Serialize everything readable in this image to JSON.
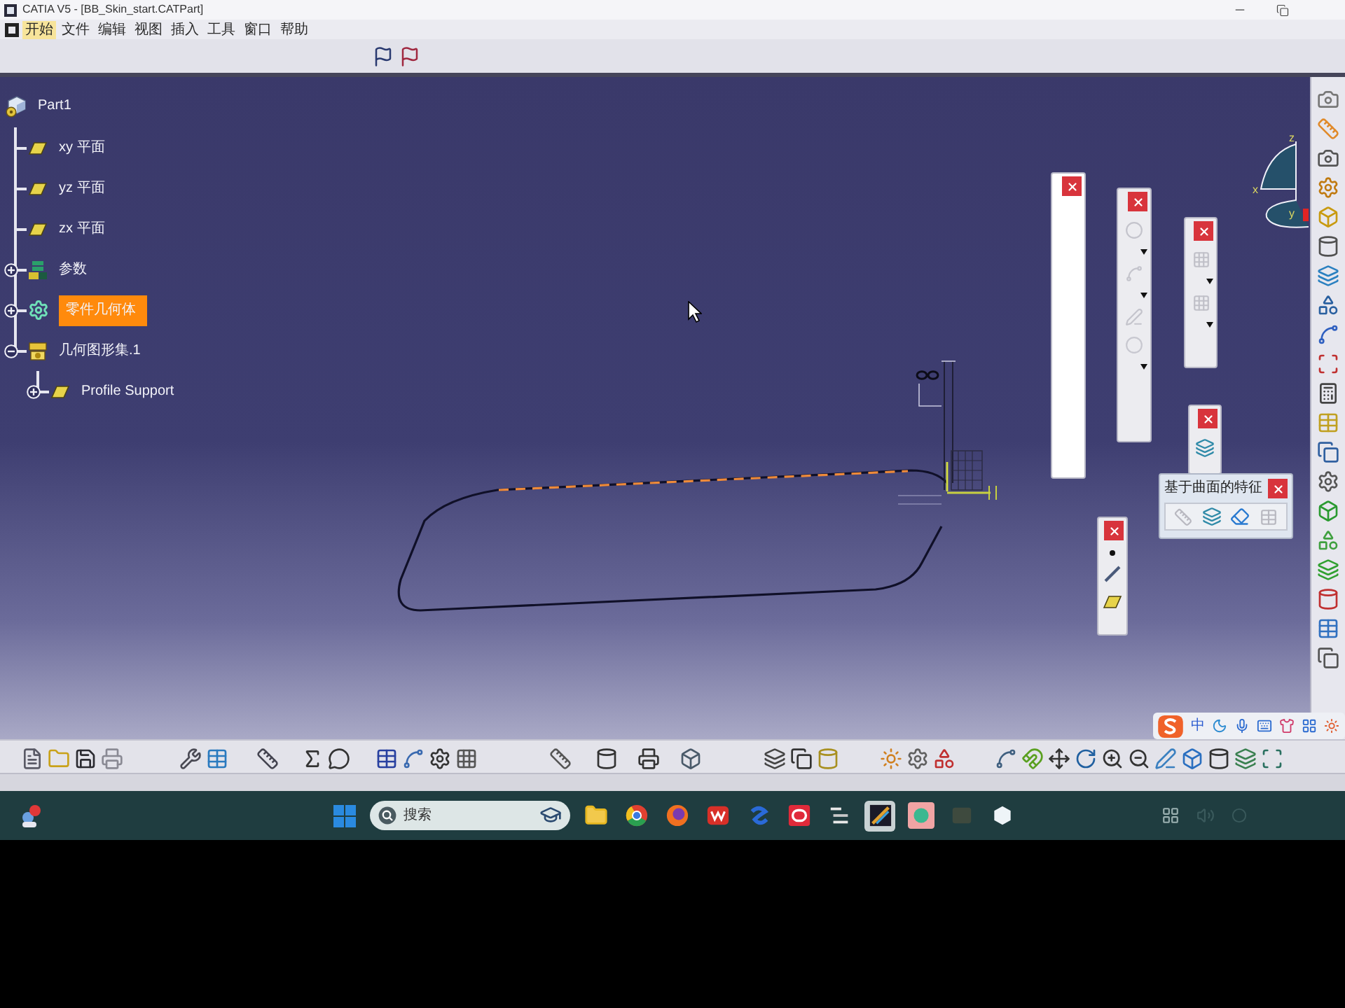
{
  "window": {
    "title": "CATIA V5 - [BB_Skin_start.CATPart]"
  },
  "menu": [
    {
      "label": "开始",
      "selected": true
    },
    {
      "label": "文件",
      "selected": false
    },
    {
      "label": "编辑",
      "selected": false
    },
    {
      "label": "视图",
      "selected": false
    },
    {
      "label": "插入",
      "selected": false
    },
    {
      "label": "工具",
      "selected": false
    },
    {
      "label": "窗口",
      "selected": false
    },
    {
      "label": "帮助",
      "selected": false
    }
  ],
  "tree": {
    "label": "Part1",
    "kind": "part",
    "children": [
      {
        "label": "xy 平面",
        "kind": "plane",
        "selected": false
      },
      {
        "label": "yz 平面",
        "kind": "plane",
        "selected": false
      },
      {
        "label": "zx 平面",
        "kind": "plane",
        "selected": false
      },
      {
        "label": "参数",
        "kind": "parameters",
        "expanded": false,
        "selected": false
      },
      {
        "label": "零件几何体",
        "kind": "body",
        "expanded": false,
        "selected": true
      },
      {
        "label": "几何图形集.1",
        "kind": "geometric-set",
        "expanded": true,
        "selected": false,
        "children": [
          {
            "label": "Profile Support",
            "kind": "plane",
            "expanded": false,
            "selected": false
          }
        ]
      }
    ]
  },
  "floating_toolbar": {
    "title": "基于曲面的特征"
  },
  "compass": {
    "axes": [
      {
        "label": "z"
      },
      {
        "label": "x"
      },
      {
        "label": "y"
      }
    ]
  },
  "ime_bar": {
    "mode": "中"
  },
  "taskbar": {
    "search": {
      "placeholder": "搜索"
    },
    "apps": [
      {
        "selected": false
      },
      {
        "selected": false
      },
      {
        "selected": false
      },
      {
        "selected": false
      },
      {
        "selected": false
      },
      {
        "selected": false
      },
      {
        "selected": false
      },
      {
        "selected": true
      },
      {
        "selected": false
      },
      {
        "selected": false
      },
      {
        "selected": false
      }
    ]
  }
}
